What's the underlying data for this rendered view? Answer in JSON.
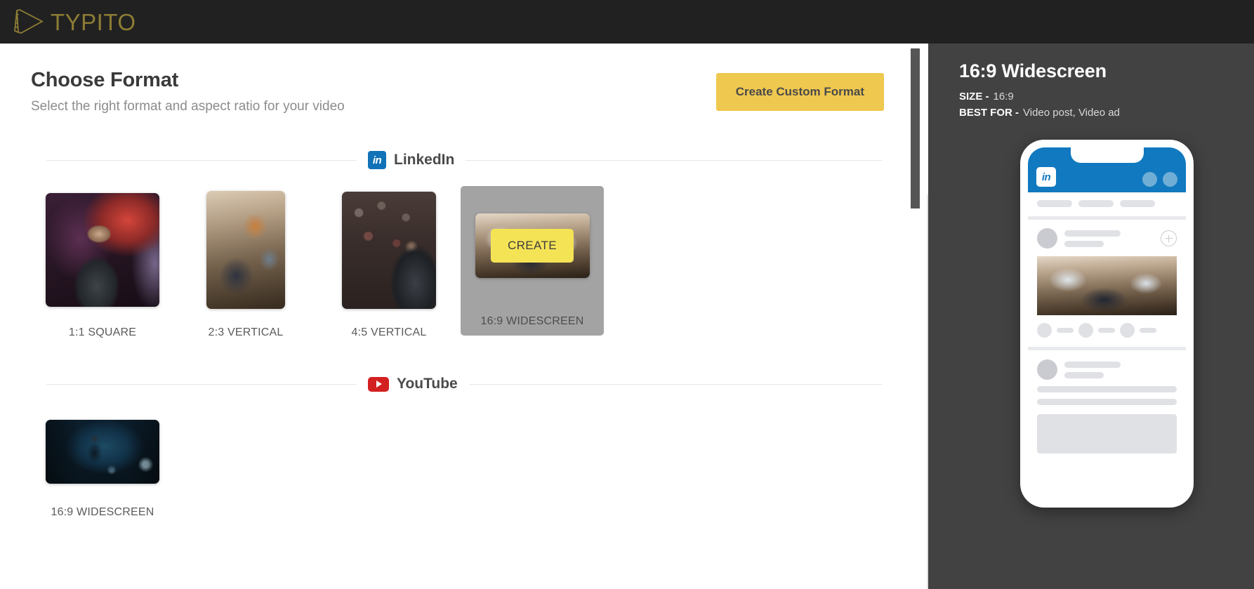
{
  "app": {
    "logo_text": "TYPITO",
    "logo_icon": "film-play-icon",
    "logo_color": "#8d7c34",
    "topbar_color": "#212121"
  },
  "main": {
    "title": "Choose Format",
    "subtitle": "Select the right format and aspect ratio for your video",
    "custom_format_button": "Create Custom Format",
    "accent_color": "#efc84f"
  },
  "sections": [
    {
      "id": "linkedin",
      "name": "LinkedIn",
      "icon": "linkedin-icon",
      "icon_glyph": "in",
      "icon_color": "#1172b8",
      "cards": [
        {
          "label": "1:1 SQUARE",
          "selected": false,
          "thumb": "speaker-stage-photo"
        },
        {
          "label": "2:3 VERTICAL",
          "selected": false,
          "thumb": "office-coworking-photo"
        },
        {
          "label": "4:5 VERTICAL",
          "selected": false,
          "thumb": "conference-audience-photo"
        },
        {
          "label": "16:9 WIDESCREEN",
          "selected": true,
          "thumb": "cowork-cafe-photo",
          "create_label": "CREATE"
        }
      ]
    },
    {
      "id": "youtube",
      "name": "YouTube",
      "icon": "youtube-icon",
      "icon_glyph": "play",
      "icon_color": "#d32020",
      "cards": [
        {
          "label": "16:9 WIDESCREEN",
          "selected": false,
          "thumb": "concert-singer-photo"
        }
      ]
    }
  ],
  "panel": {
    "title": "16:9 Widescreen",
    "size_key": "SIZE -",
    "size_value": "16:9",
    "best_for_key": "BEST FOR -",
    "best_for_value": "Video post, Video ad",
    "background_color": "#424242",
    "preview": {
      "platform_icon": "linkedin-icon",
      "platform_icon_glyph": "in",
      "bar_color": "#1179bf"
    }
  }
}
